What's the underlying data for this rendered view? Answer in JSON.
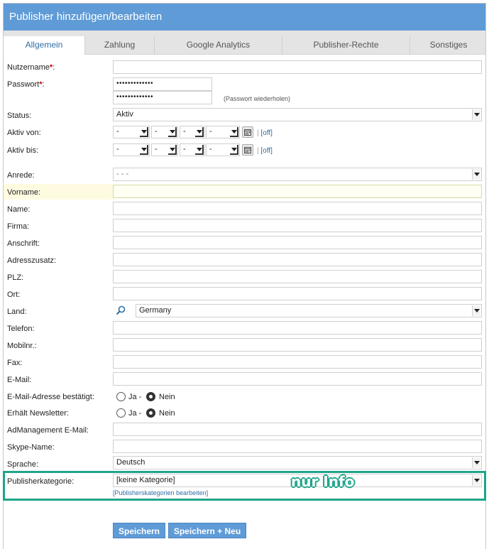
{
  "title": "Publisher hinzufügen/bearbeiten",
  "tabs": [
    {
      "label": "Allgemein",
      "active": true
    },
    {
      "label": "Zahlung",
      "active": false
    },
    {
      "label": "Google Analytics",
      "active": false
    },
    {
      "label": "Publisher-Rechte",
      "active": false
    },
    {
      "label": "Sonstiges",
      "active": false
    }
  ],
  "fields": {
    "username": {
      "label": "Nutzername",
      "required": "*",
      "suffix": ":",
      "value": ""
    },
    "password": {
      "label": "Passwort",
      "required": "*",
      "suffix": ":",
      "value": "•••••••••••••",
      "repeat_value": "•••••••••••••",
      "repeat_hint": "(Passwort wiederholen)"
    },
    "status": {
      "label": "Status:",
      "value": "Aktiv"
    },
    "active_from": {
      "label": "Aktiv von:",
      "day": "-",
      "month": "-",
      "year": "-",
      "hour": "-",
      "off_label": "[off]",
      "sep": "|"
    },
    "active_to": {
      "label": "Aktiv bis:",
      "day": "-",
      "month": "-",
      "year": "-",
      "hour": "-",
      "off_label": "[off]",
      "sep": "|"
    },
    "salutation": {
      "label": "Anrede:",
      "value": "- - -"
    },
    "firstname": {
      "label": "Vorname:"
    },
    "name": {
      "label": "Name:"
    },
    "company": {
      "label": "Firma:"
    },
    "address": {
      "label": "Anschrift:"
    },
    "address_extra": {
      "label": "Adresszusatz:"
    },
    "zip": {
      "label": "PLZ:"
    },
    "city": {
      "label": "Ort:"
    },
    "country": {
      "label": "Land:",
      "value": "Germany"
    },
    "phone": {
      "label": "Telefon:"
    },
    "mobile": {
      "label": "Mobilnr.:"
    },
    "fax": {
      "label": "Fax:"
    },
    "email": {
      "label": "E-Mail:"
    },
    "email_confirmed": {
      "label": "E-Mail-Adresse bestätigt:",
      "yes": "Ja -",
      "no": "Nein",
      "selected": "no"
    },
    "newsletter": {
      "label": "Erhält Newsletter:",
      "yes": "Ja -",
      "no": "Nein",
      "selected": "no"
    },
    "adm_email": {
      "label": "AdManagement E-Mail:"
    },
    "skype": {
      "label": "Skype-Name:"
    },
    "language": {
      "label": "Sprache:",
      "value": "Deutsch"
    },
    "category": {
      "label": "Publisherkategorie:",
      "value": "[keine Kategorie]",
      "edit_link": "[Publisherskategorien bearbeiten]"
    }
  },
  "annotation": {
    "text": "nur Info",
    "color": "#1fa58a"
  },
  "buttons": {
    "save": "Speichern",
    "save_new": "Speichern + Neu"
  },
  "colors": {
    "header": "#5f9bd6",
    "link": "#2e6da4",
    "required": "#cc0000"
  }
}
